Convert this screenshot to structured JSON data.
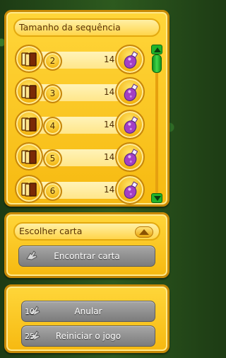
{
  "sequence_panel": {
    "title": "Tamanho da sequência",
    "rows": [
      {
        "length": "2",
        "cost": "14"
      },
      {
        "length": "3",
        "cost": "14"
      },
      {
        "length": "4",
        "cost": "14"
      },
      {
        "length": "5",
        "cost": "14"
      },
      {
        "length": "6",
        "cost": "14"
      }
    ]
  },
  "find_panel": {
    "title": "Escolher carta",
    "find_button_label": "Encontrar carta"
  },
  "actions_panel": {
    "undo_label": "Anular",
    "undo_cost": "10",
    "restart_label": "Reiniciar o jogo",
    "restart_cost": "25"
  },
  "icons": {
    "row_left_icon": "card-stack-icon",
    "row_right_icon": "purple-potion-icon",
    "button_icon": "hand-icon",
    "scroll_up": "arrow-up-icon",
    "scroll_down": "arrow-down-icon",
    "collapse": "triangle-up-icon"
  },
  "colors": {
    "panel_gold": "#f6b910",
    "button_grey": "#8a8a8a",
    "scroll_green": "#21b32a",
    "potion_purple": "#a33fc4"
  }
}
